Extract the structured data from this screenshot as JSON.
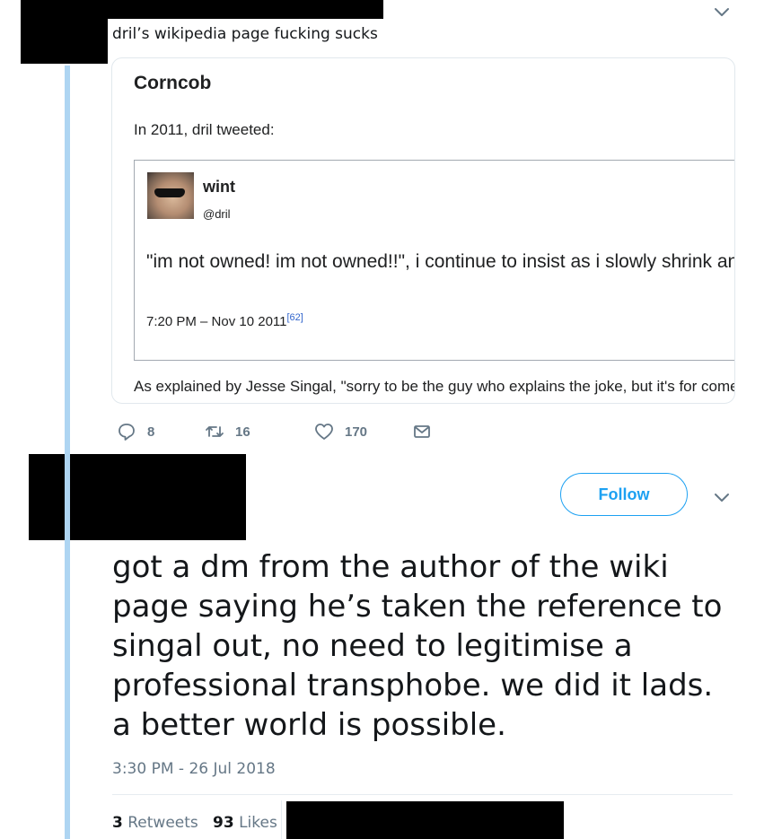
{
  "tweet1": {
    "text": "dril’s wikipedia page fucking sucks",
    "card": {
      "title": "Corncob",
      "intro": "In 2011, dril tweeted:",
      "embedded": {
        "name": "wint",
        "handle": "@dril",
        "text": "\"im not owned! im not owned!!\", i continue to insist as i slowly shrink and transform into a corncob",
        "date": "7:20 PM – Nov 10 2011",
        "ref": "[62]"
      },
      "footer": "As explained by Jesse Singal, \"sorry to be the guy who explains the joke, but it's for comedic effect\""
    },
    "actions": {
      "replies": "8",
      "retweets": "16",
      "likes": "170"
    }
  },
  "tweet2": {
    "follow_label": "Follow",
    "text": "got a dm from the author of the wiki page saying he’s taken the reference to singal out, no need to legitimise a professional transphobe. we did it lads. a better world is possible.",
    "time": "3:30 PM - 26 Jul 2018",
    "retweets_count": "3",
    "retweets_label": "Retweets",
    "likes_count": "93",
    "likes_label": "Likes"
  },
  "icons": {
    "reply": "reply-icon",
    "retweet": "retweet-icon",
    "like": "heart-icon",
    "dm": "envelope-icon",
    "more": "chevron-down-icon"
  },
  "colors": {
    "accent": "#1da1f2",
    "thread_line": "#aed5f2",
    "muted": "#657786"
  }
}
